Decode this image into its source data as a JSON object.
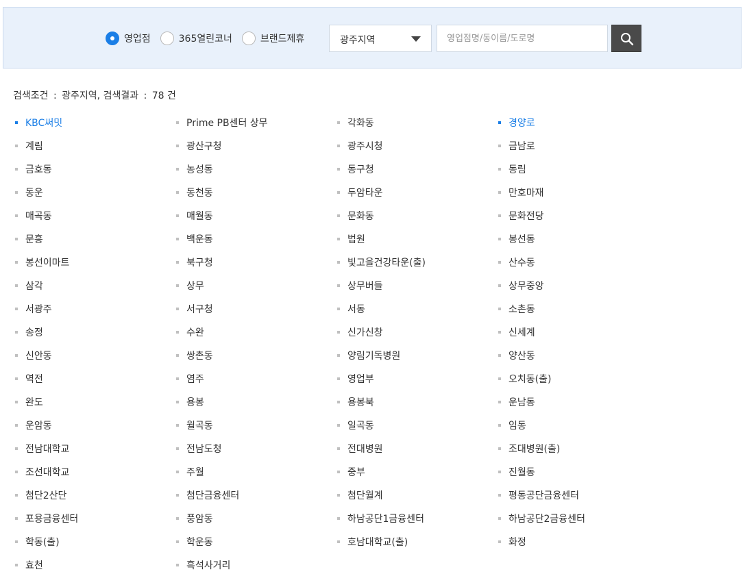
{
  "search": {
    "radio_options": [
      {
        "label": "영업점",
        "selected": true
      },
      {
        "label": "365열린코너",
        "selected": false
      },
      {
        "label": "브랜드제휴",
        "selected": false
      }
    ],
    "region_selected": "광주지역",
    "placeholder": "영업점명/동이름/도로명",
    "button_icon": "search-icon"
  },
  "result": {
    "condition_label": "검색조건",
    "region": "광주지역,",
    "result_label": "검색결과",
    "count": "78",
    "unit": "건"
  },
  "colors": {
    "accent": "#1a7ee6",
    "panel_bg": "#e9f1fb",
    "button_bg": "#4a4a4a"
  },
  "branches": [
    {
      "name": "KBC써밋",
      "highlight": true
    },
    {
      "name": "Prime PB센터 상무",
      "highlight": false
    },
    {
      "name": "각화동",
      "highlight": false
    },
    {
      "name": "경양로",
      "highlight": true
    },
    {
      "name": "계림",
      "highlight": false
    },
    {
      "name": "광산구청",
      "highlight": false
    },
    {
      "name": "광주시청",
      "highlight": false
    },
    {
      "name": "금남로",
      "highlight": false
    },
    {
      "name": "금호동",
      "highlight": false
    },
    {
      "name": "농성동",
      "highlight": false
    },
    {
      "name": "동구청",
      "highlight": false
    },
    {
      "name": "동림",
      "highlight": false
    },
    {
      "name": "동운",
      "highlight": false
    },
    {
      "name": "동천동",
      "highlight": false
    },
    {
      "name": "두암타운",
      "highlight": false
    },
    {
      "name": "만호마재",
      "highlight": false
    },
    {
      "name": "매곡동",
      "highlight": false
    },
    {
      "name": "매월동",
      "highlight": false
    },
    {
      "name": "문화동",
      "highlight": false
    },
    {
      "name": "문화전당",
      "highlight": false
    },
    {
      "name": "문흥",
      "highlight": false
    },
    {
      "name": "백운동",
      "highlight": false
    },
    {
      "name": "법원",
      "highlight": false
    },
    {
      "name": "봉선동",
      "highlight": false
    },
    {
      "name": "봉선이마트",
      "highlight": false
    },
    {
      "name": "북구청",
      "highlight": false
    },
    {
      "name": "빛고을건강타운(출)",
      "highlight": false
    },
    {
      "name": "산수동",
      "highlight": false
    },
    {
      "name": "삼각",
      "highlight": false
    },
    {
      "name": "상무",
      "highlight": false
    },
    {
      "name": "상무버들",
      "highlight": false
    },
    {
      "name": "상무중앙",
      "highlight": false
    },
    {
      "name": "서광주",
      "highlight": false
    },
    {
      "name": "서구청",
      "highlight": false
    },
    {
      "name": "서동",
      "highlight": false
    },
    {
      "name": "소촌동",
      "highlight": false
    },
    {
      "name": "송정",
      "highlight": false
    },
    {
      "name": "수완",
      "highlight": false
    },
    {
      "name": "신가신창",
      "highlight": false
    },
    {
      "name": "신세계",
      "highlight": false
    },
    {
      "name": "신안동",
      "highlight": false
    },
    {
      "name": "쌍촌동",
      "highlight": false
    },
    {
      "name": "양림기독병원",
      "highlight": false
    },
    {
      "name": "양산동",
      "highlight": false
    },
    {
      "name": "역전",
      "highlight": false
    },
    {
      "name": "염주",
      "highlight": false
    },
    {
      "name": "영업부",
      "highlight": false
    },
    {
      "name": "오치동(출)",
      "highlight": false
    },
    {
      "name": "완도",
      "highlight": false
    },
    {
      "name": "용봉",
      "highlight": false
    },
    {
      "name": "용봉북",
      "highlight": false
    },
    {
      "name": "운남동",
      "highlight": false
    },
    {
      "name": "운암동",
      "highlight": false
    },
    {
      "name": "월곡동",
      "highlight": false
    },
    {
      "name": "일곡동",
      "highlight": false
    },
    {
      "name": "임동",
      "highlight": false
    },
    {
      "name": "전남대학교",
      "highlight": false
    },
    {
      "name": "전남도청",
      "highlight": false
    },
    {
      "name": "전대병원",
      "highlight": false
    },
    {
      "name": "조대병원(출)",
      "highlight": false
    },
    {
      "name": "조선대학교",
      "highlight": false
    },
    {
      "name": "주월",
      "highlight": false
    },
    {
      "name": "중부",
      "highlight": false
    },
    {
      "name": "진월동",
      "highlight": false
    },
    {
      "name": "첨단2산단",
      "highlight": false
    },
    {
      "name": "첨단금융센터",
      "highlight": false
    },
    {
      "name": "첨단월계",
      "highlight": false
    },
    {
      "name": "평동공단금융센터",
      "highlight": false
    },
    {
      "name": "포용금융센터",
      "highlight": false
    },
    {
      "name": "풍암동",
      "highlight": false
    },
    {
      "name": "하남공단1금융센터",
      "highlight": false
    },
    {
      "name": "하남공단2금융센터",
      "highlight": false
    },
    {
      "name": "학동(출)",
      "highlight": false
    },
    {
      "name": "학운동",
      "highlight": false
    },
    {
      "name": "호남대학교(출)",
      "highlight": false
    },
    {
      "name": "화정",
      "highlight": false
    },
    {
      "name": "효천",
      "highlight": false
    },
    {
      "name": "흑석사거리",
      "highlight": false
    }
  ]
}
